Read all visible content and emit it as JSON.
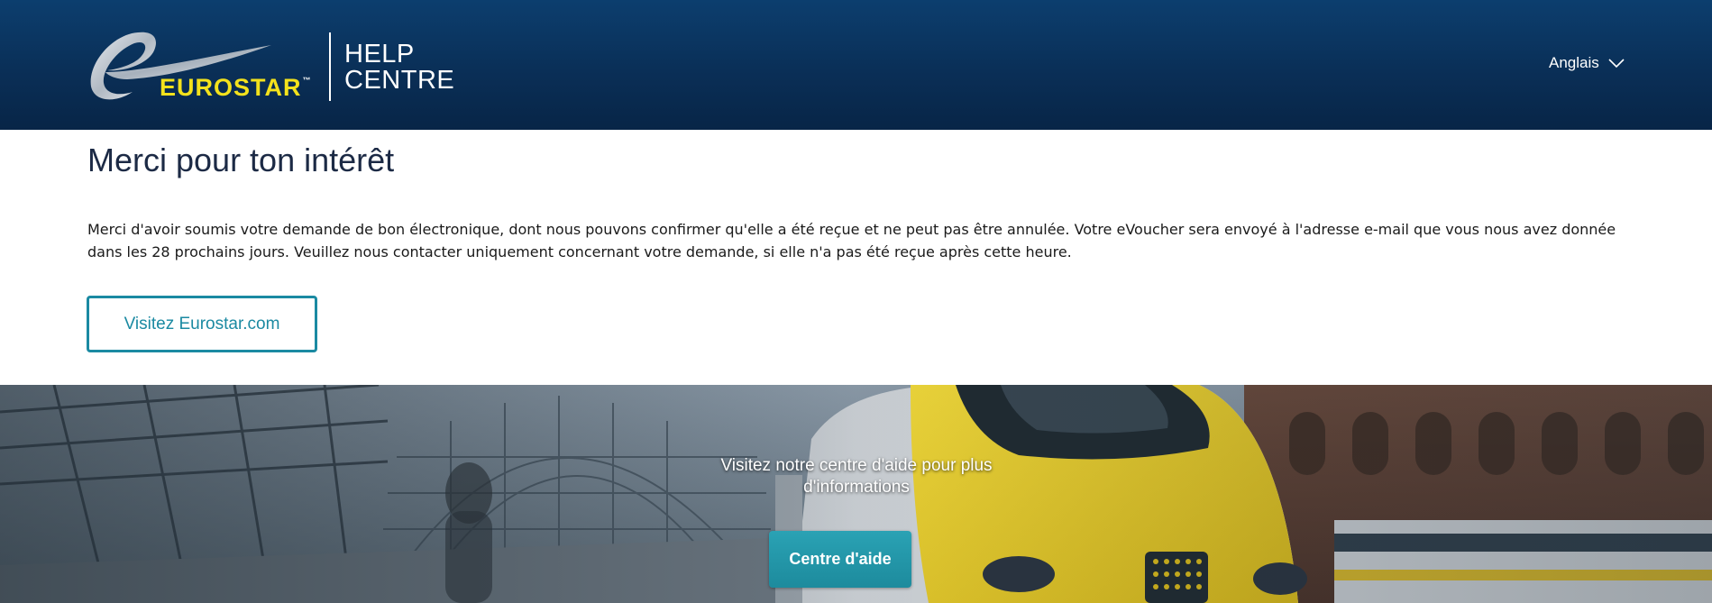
{
  "header": {
    "logo_text": "EUROSTAR",
    "logo_trademark": "™",
    "help_centre_line1": "HELP",
    "help_centre_line2": "CENTRE",
    "language": "Anglais",
    "language_icon": "chevron-down-icon"
  },
  "main": {
    "title": "Merci pour ton intérêt",
    "message": "Merci d'avoir soumis votre demande de bon électronique, dont nous pouvons confirmer qu'elle a été reçue et ne peut pas être annulée. Votre eVoucher sera envoyé à l'adresse e-mail que vous nous avez donnée dans les 28 prochains jours. Veuillez nous contacter uniquement concernant votre demande, si elle n'a pas été reçue après cette heure.",
    "visit_button": "Visitez Eurostar.com"
  },
  "hero": {
    "text": "Visitez notre centre d'aide pour plus d'informations",
    "button": "Centre d'aide"
  },
  "colors": {
    "header_bg": "#0a2f57",
    "logo_yellow": "#f4e21c",
    "accent_teal": "#1b8aa2",
    "title_text": "#1c2a45"
  }
}
